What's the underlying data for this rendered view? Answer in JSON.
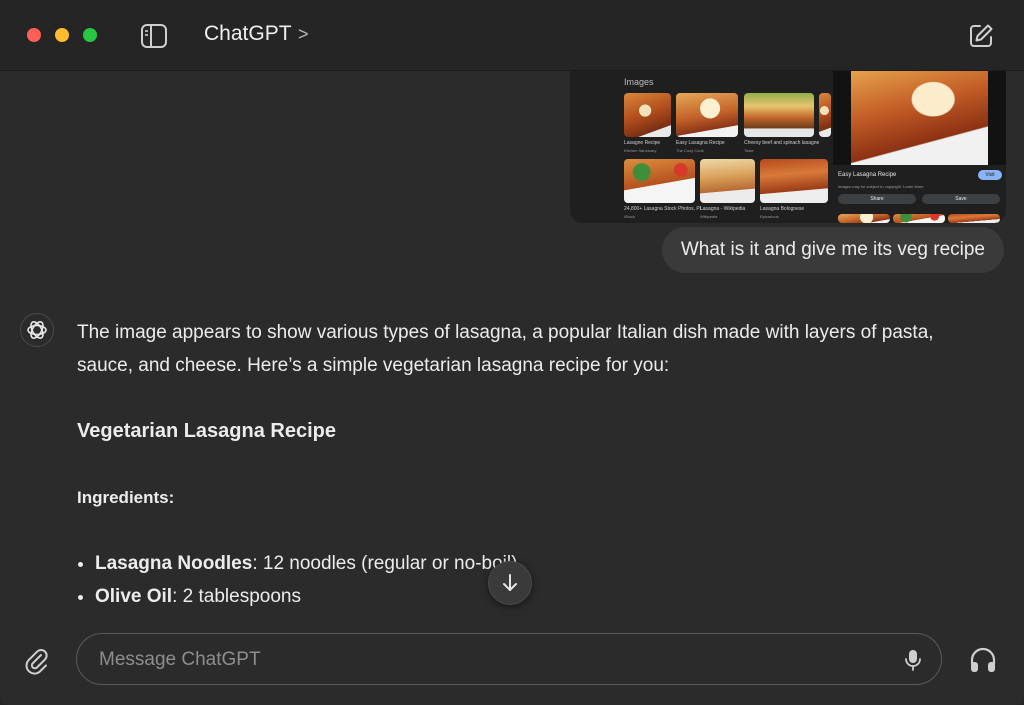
{
  "window": {
    "title": "ChatGPT",
    "title_chevron": ">"
  },
  "icons": {
    "sidebar_toggle": "sidebar-icon",
    "new_chat": "compose-icon",
    "attach": "paperclip-icon",
    "mic": "microphone-icon",
    "voice": "headphones-icon",
    "scroll_down": "arrow-down-icon",
    "assistant_avatar": "openai-logo-icon"
  },
  "upload": {
    "section_label": "Images",
    "thumbnails": [
      {
        "caption": "Lasagne Recipe",
        "source": "Kitchen Sanctuary"
      },
      {
        "caption": "Easy Lasagna Recipe",
        "source": "The Cozy Cook"
      },
      {
        "caption": "Cheesy beef and spinach lasagne",
        "source": "Taste"
      },
      {
        "caption": "24,800+ Lasagna Stock Photos, Pi...",
        "source": "iStock"
      },
      {
        "caption": "Lasagna - Wikipedia",
        "source": "Wikipedia"
      },
      {
        "caption": "Lasagna Bolognese",
        "source": "Epicurious"
      }
    ],
    "preview": {
      "title": "Easy Lasagna Recipe",
      "subtitle": "Images may be subject to copyright. Learn More",
      "visit": "Visit",
      "share": "Share",
      "save": "Save"
    }
  },
  "user_message": "What is it and give me its veg recipe",
  "assistant": {
    "intro": "The image appears to show various types of lasagna, a popular Italian dish made with layers of pasta, sauce, and cheese. Here’s a simple vegetarian lasagna recipe for you:",
    "heading": "Vegetarian Lasagna Recipe",
    "ingredients_heading": "Ingredients:",
    "ingredients": [
      {
        "name": "Lasagna Noodles",
        "detail": ": 12 noodles (regular or no-boil)"
      },
      {
        "name": "Olive Oil",
        "detail": ": 2 tablespoons"
      }
    ]
  },
  "composer": {
    "placeholder": "Message ChatGPT",
    "value": ""
  },
  "colors": {
    "red": "#ff5f57",
    "yellow": "#febc2e",
    "green": "#28c840",
    "background": "#2b2b2b",
    "bubble": "#3a3a3a"
  }
}
